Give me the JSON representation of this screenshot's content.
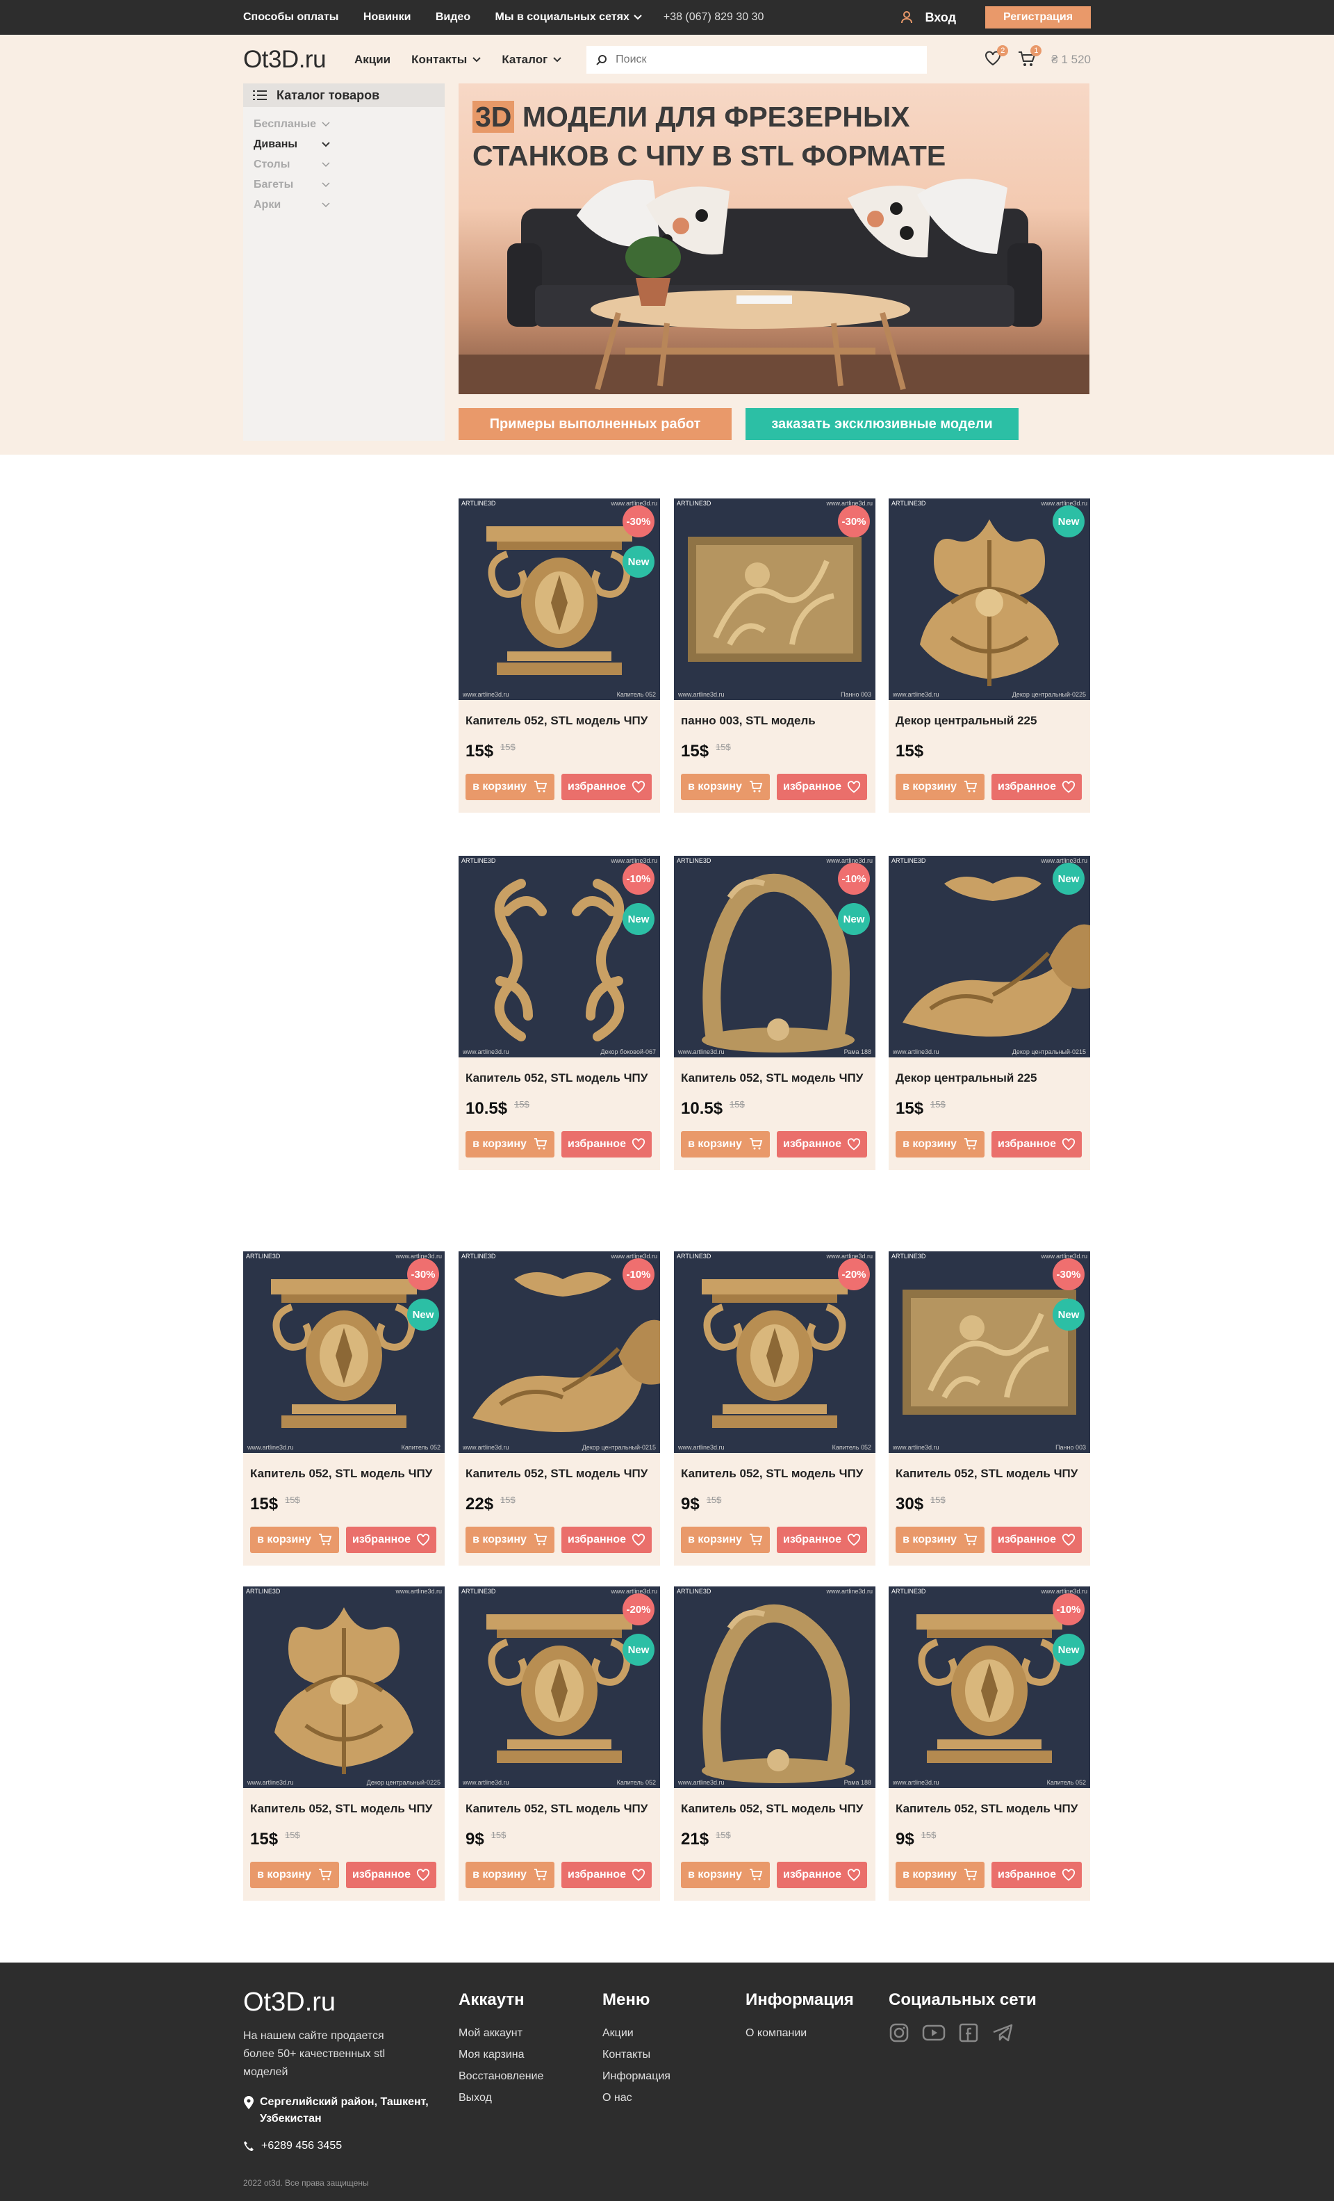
{
  "topbar": {
    "links": [
      "Способы оплаты",
      "Новинки",
      "Видео",
      "Мы в социальных сетях"
    ],
    "phone": "+38 (067) 829 30 30",
    "login": "Вход",
    "register": "Регистрация"
  },
  "header": {
    "logo": "Ot3D.ru",
    "nav": [
      "Акции",
      "Контакты",
      "Каталог"
    ],
    "search_placeholder": "Поиск",
    "fav_count": "2",
    "cart_count": "1",
    "balance": "₴ 1 520"
  },
  "sidebar": {
    "title": "Каталог товаров",
    "items": [
      "Беспланые",
      "Диваны",
      "Столы",
      "Багеты",
      "Арки"
    ]
  },
  "banner": {
    "title_hl": "3D",
    "title_rest": " модели для фрезерных",
    "title_line2": "станков с ЧПУ в STL формате",
    "btn_works": "Примеры выполненных работ",
    "btn_exclusive": "заказать эксклюзивные модели"
  },
  "common": {
    "to_cart": "в корзину",
    "favorite": "избранное",
    "watermark": "ARTLINE3D",
    "site": "www.artline3d.ru",
    "new": "New"
  },
  "products": [
    {
      "title": "Капитель 052, STL модель ЧПУ",
      "price": "15$",
      "old": "15$",
      "disc": "-30%",
      "new": true,
      "kind": "capital",
      "cap": "Капитель 052"
    },
    {
      "title": "панно 003, STL модель",
      "price": "15$",
      "old": "15$",
      "disc": "-30%",
      "new": false,
      "kind": "panel",
      "cap": "Панно 003"
    },
    {
      "title": "Декор центральный 225",
      "price": "15$",
      "old": "",
      "disc": "",
      "new": true,
      "kind": "decor",
      "cap": "Декор центральный-0225"
    },
    {
      "title": "Капитель 052, STL модель ЧПУ",
      "price": "10.5$",
      "old": "15$",
      "disc": "-10%",
      "new": true,
      "kind": "scroll",
      "cap": "Декор боковой-067"
    },
    {
      "title": "Капитель 052, STL модель ЧПУ",
      "price": "10.5$",
      "old": "15$",
      "disc": "-10%",
      "new": true,
      "kind": "arch",
      "cap": "Рама 188"
    },
    {
      "title": "Декор центральный 225",
      "price": "15$",
      "old": "15$",
      "disc": "",
      "new": true,
      "kind": "corner",
      "cap": "Декор центральный-0215"
    },
    {
      "title": "Капитель 052, STL модель ЧПУ",
      "price": "15$",
      "old": "15$",
      "disc": "-30%",
      "new": true,
      "kind": "capital",
      "cap": "Капитель 052"
    },
    {
      "title": "Капитель 052, STL модель ЧПУ",
      "price": "22$",
      "old": "15$",
      "disc": "-10%",
      "new": false,
      "kind": "corner",
      "cap": "Декор центральный-0215"
    },
    {
      "title": "Капитель 052, STL модель ЧПУ",
      "price": "9$",
      "old": "15$",
      "disc": "-20%",
      "new": false,
      "kind": "capital",
      "cap": "Капитель 052"
    },
    {
      "title": "Капитель 052, STL модель ЧПУ",
      "price": "30$",
      "old": "15$",
      "disc": "-30%",
      "new": true,
      "kind": "panel",
      "cap": "Панно 003"
    },
    {
      "title": "Капитель 052, STL модель ЧПУ",
      "price": "15$",
      "old": "15$",
      "disc": "",
      "new": false,
      "kind": "decor",
      "cap": "Декор центральный-0225"
    },
    {
      "title": "Капитель 052, STL модель ЧПУ",
      "price": "9$",
      "old": "15$",
      "disc": "-20%",
      "new": true,
      "kind": "capital",
      "cap": "Капитель 052"
    },
    {
      "title": "Капитель 052, STL модель ЧПУ",
      "price": "21$",
      "old": "15$",
      "disc": "",
      "new": false,
      "kind": "arch",
      "cap": "Рама 188"
    },
    {
      "title": "Капитель 052, STL модель ЧПУ",
      "price": "9$",
      "old": "15$",
      "disc": "-10%",
      "new": true,
      "kind": "capital",
      "cap": "Капитель 052"
    }
  ],
  "footer": {
    "logo": "Ot3D.ru",
    "about": "На нашем сайте продается более 50+ качественных stl моделей",
    "address": "Сергелийский район, Ташкент, Узбекистан",
    "phone": "+6289 456 3455",
    "account_h": "Аккаутн",
    "account": [
      "Мой аккаунт",
      "Моя карзина",
      "Восстановление",
      "Выход"
    ],
    "menu_h": "Меню",
    "menu": [
      "Акции",
      "Контакты",
      "Информация",
      "О нас"
    ],
    "info_h": "Информация",
    "info": [
      "О компании"
    ],
    "social_h": "Социальных сети",
    "social_icons": [
      "instagram-icon",
      "youtube-icon",
      "facebook-icon",
      "telegram-icon"
    ],
    "copyright": "2022 ot3d. Все права защищены"
  },
  "colors": {
    "accent": "#e9996a",
    "teal": "#2cbfa5",
    "red": "#ef6f6f",
    "dark": "#2d2d2d",
    "cream": "#f9eee4"
  }
}
